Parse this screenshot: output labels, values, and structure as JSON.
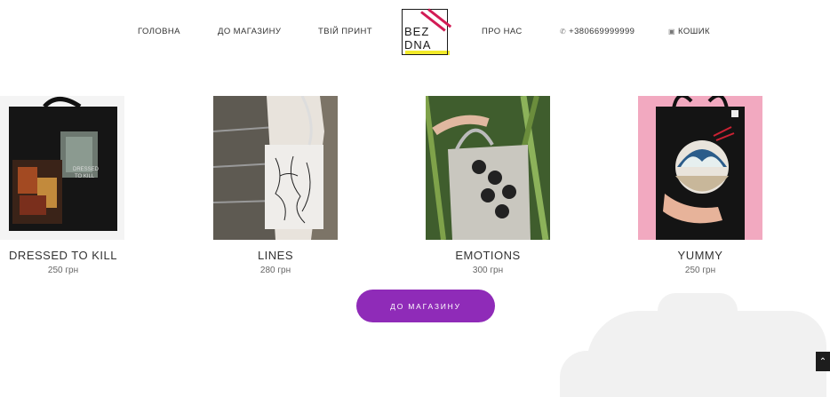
{
  "nav": {
    "home": "ГОЛОВНА",
    "shop": "ДО МАГАЗИНУ",
    "print": "ТВІЙ ПРИНТ",
    "about": "ПРО НАС",
    "phone": "+380669999999",
    "phone_icon": "phone-icon",
    "cart": "КОШИК",
    "cart_icon": "bag-icon"
  },
  "logo": {
    "line1": "BEZ",
    "line2": "DNA",
    "accent": "#d21b55",
    "underline": "#f2ea2a"
  },
  "products": [
    {
      "name": "DRESSED TO KILL",
      "price": "250 грн"
    },
    {
      "name": "LINES",
      "price": "280 грн"
    },
    {
      "name": "EMOTIONS",
      "price": "300 грн"
    },
    {
      "name": "YUMMY",
      "price": "250 грн"
    }
  ],
  "cta": {
    "label": "ДО МАГАЗИНУ",
    "color": "#8f2bb8"
  },
  "scroll_top_icon": "arrow-up-icon"
}
